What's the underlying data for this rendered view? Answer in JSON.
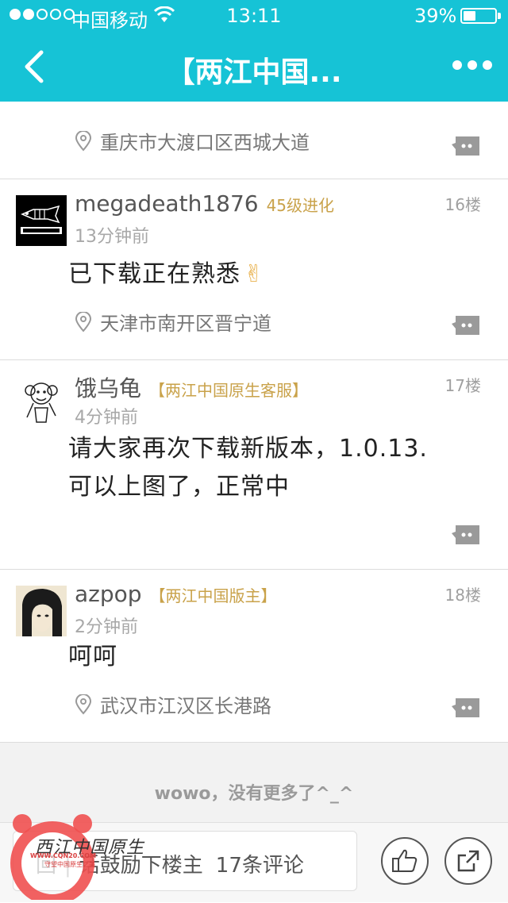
{
  "status_bar": {
    "carrier": "中国移动",
    "time": "13:11",
    "battery_percent": "39%",
    "battery_level": 0.39,
    "signal_bars": 2
  },
  "nav": {
    "title": "【两江中国..."
  },
  "posts": [
    {
      "location": "重庆市大渡口区西城大道"
    },
    {
      "username": "megadeath1876",
      "badge": "45级进化",
      "floor": "16楼",
      "time": "13分钟前",
      "content": "已下载正在熟悉",
      "emoji": "✌",
      "location": "天津市南开区晋宁道"
    },
    {
      "username": "饿乌龟",
      "badge": "【两江中国原生客服】",
      "floor": "17楼",
      "time": "4分钟前",
      "content_line1": "请大家再次下载新版本，1.0.13.",
      "content_line2": "可以上图了，正常中"
    },
    {
      "username": "azpop",
      "badge": "【两江中国版主】",
      "floor": "18楼",
      "time": "2分钟前",
      "content": "呵呵",
      "location": "武汉市江汉区长港路"
    }
  ],
  "footer": {
    "no_more": "wowo，没有更多了^_^"
  },
  "bottom_bar": {
    "reply_label": "回",
    "reply_hint": "话鼓励下楼主",
    "comment_count": "17条评论"
  },
  "watermark": {
    "logo_text": "西江中国原生",
    "url": "WWW.CQN20.COM",
    "slogan": "守望中国原生之美"
  },
  "colors": {
    "brand": "#16c3d6",
    "badge": "#c9a24a"
  }
}
